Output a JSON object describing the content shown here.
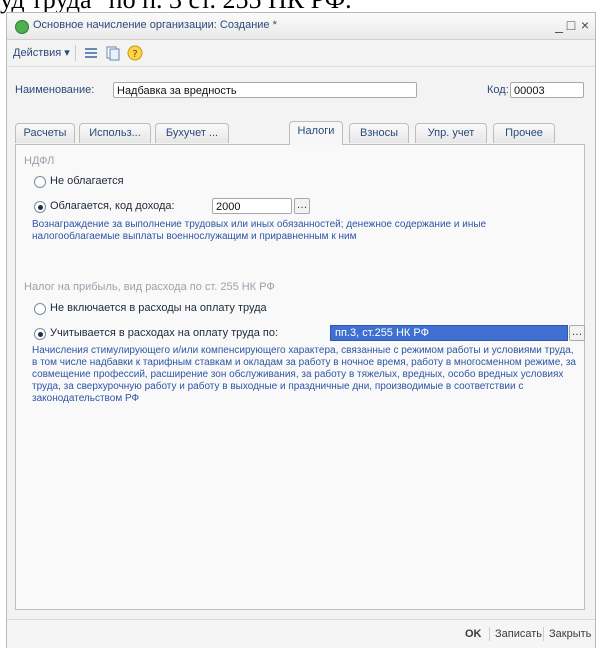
{
  "caption": {
    "text": "уд труда\" по п. 3 ст. 255 НК РФ."
  },
  "window": {
    "title": "Основное начисление организации: Создание *",
    "controls": {
      "minimize": "_",
      "maximize": "□",
      "close": "×"
    }
  },
  "toolbar": {
    "actions_label": "Действия ▾",
    "icons": [
      "list-icon",
      "copy-icon",
      "help-icon"
    ]
  },
  "form": {
    "name_label": "Наименование:",
    "name_value": "Надбавка за вредность",
    "code_label": "Код:",
    "code_value": "00003"
  },
  "tabs": [
    {
      "label": "Расчеты"
    },
    {
      "label": "Использ..."
    },
    {
      "label": "Бухучет ..."
    },
    {
      "label": "Налоги"
    },
    {
      "label": "Взносы"
    },
    {
      "label": "Упр. учет"
    },
    {
      "label": "Прочее"
    }
  ],
  "active_tab": "Налоги",
  "ndfl": {
    "title": "НДФЛ",
    "option_not_taxed": "Не облагается",
    "option_taxed": "Облагается, код дохода:",
    "income_code": "2000",
    "description": "Вознаграждение за выполнение трудовых или иных обязанностей; денежное содержание и иные налогооблагаемые выплаты военнослужащим и приравненным к ним"
  },
  "profit_tax": {
    "title": "Налог на прибыль, вид расхода по ст. 255 НК РФ",
    "option_not_included": "Не включается в расходы на оплату труда",
    "option_included": "Учитывается в расходах на оплату труда по:",
    "selected_value": "пп.3, ст.255 НК РФ",
    "description": "Начисления стимулирующего и/или компенсирующего характера, связанные с режимом работы и условиями труда, в том числе надбавки к тарифным ставкам и окладам за работу в ночное время, работу в многосменном режиме, за совмещение профессий, расширение зон обслуживания, за работу в тяжелых, вредных, особо вредных условиях труда, за сверхурочную работу и работу в выходные и праздничные дни, производимые в соответствии с законодательством РФ"
  },
  "footer": {
    "ok": "OK",
    "save": "Записать",
    "close": "Закрыть"
  },
  "colors": {
    "accent_blue": "#2f56a6",
    "selection": "#3f6fd1"
  }
}
